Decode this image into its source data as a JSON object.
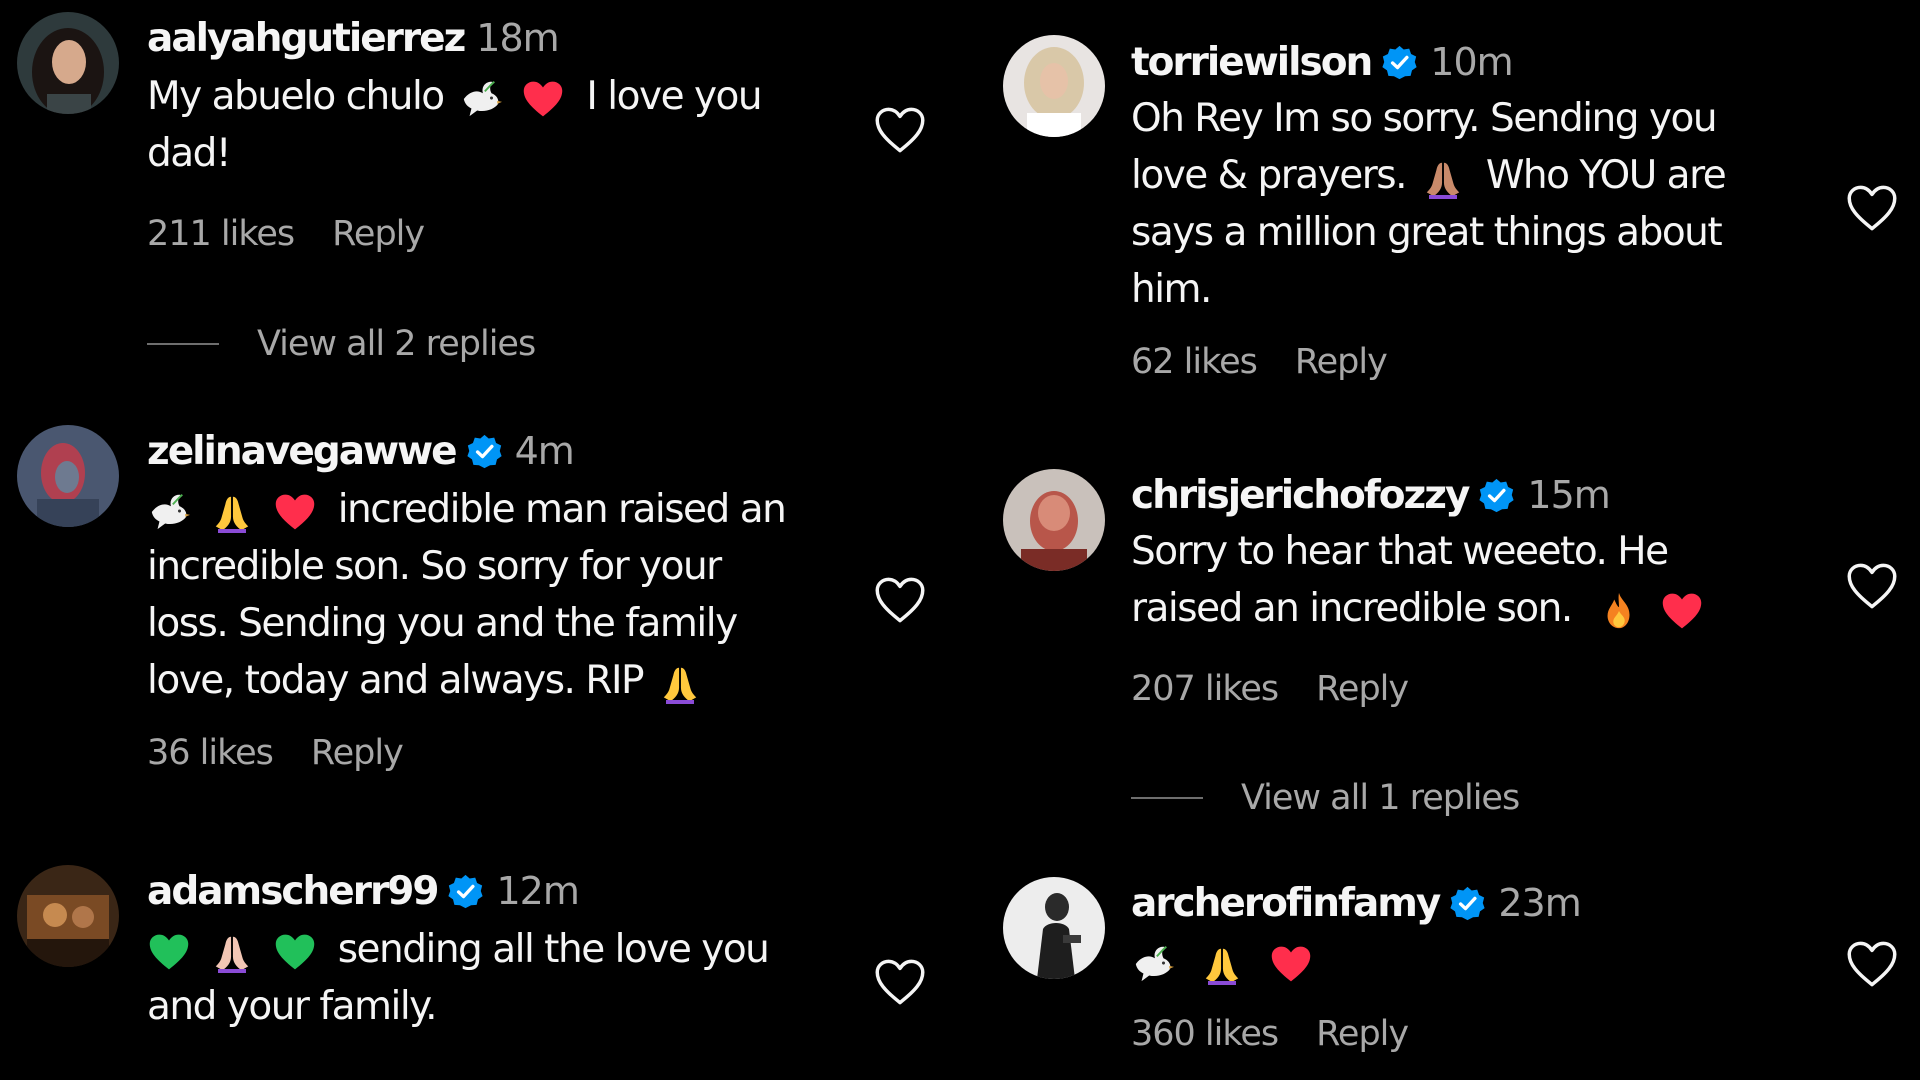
{
  "colors": {
    "background": "#000000",
    "text": "#f5f5f5",
    "muted": "#a8a8a8",
    "verified": "#0095f6",
    "heart_red": "#ff2e4c",
    "heart_green": "#21c05a",
    "hands_yellow": "#ffc83d",
    "hands_purple": "#8a4bd6"
  },
  "comments": [
    {
      "username": "aalyahgutierrez",
      "verified": false,
      "time": "18m",
      "lines": [
        "My abuelo chulo",
        "dad!"
      ],
      "line1_tail": "I love you",
      "likes": "211 likes",
      "reply": "Reply",
      "view_replies": "View all 2 replies",
      "icons": [
        "dove-icon",
        "red-heart-icon",
        "heart-outline-icon"
      ]
    },
    {
      "username": "zelinavegawwe",
      "verified": true,
      "time": "4m",
      "lines": [
        "incredible man raised an",
        "incredible son. So sorry for your",
        "loss. Sending you and the family",
        "love, today and always. RIP"
      ],
      "likes": "36 likes",
      "reply": "Reply",
      "icons": [
        "dove-icon",
        "praying-hands-icon",
        "red-heart-icon",
        "verified-icon",
        "heart-outline-icon"
      ]
    },
    {
      "username": "adamscherr99",
      "verified": true,
      "time": "12m",
      "lines": [
        "sending all the love you",
        "and your family."
      ],
      "icons": [
        "green-heart-icon",
        "praying-hands-icon",
        "verified-icon",
        "heart-outline-icon"
      ]
    },
    {
      "username": "torriewilson",
      "verified": true,
      "time": "10m",
      "lines": [
        "Oh Rey Im so sorry. Sending you",
        "love & prayers.",
        "says a million great things about",
        "him."
      ],
      "line2_tail": "Who YOU are",
      "likes": "62 likes",
      "reply": "Reply",
      "icons": [
        "praying-hands-icon",
        "verified-icon",
        "heart-outline-icon"
      ]
    },
    {
      "username": "chrisjerichofozzy",
      "verified": true,
      "time": "15m",
      "lines": [
        "Sorry to hear that weeeto. He",
        "raised an incredible son."
      ],
      "likes": "207 likes",
      "reply": "Reply",
      "view_replies": "View all 1 replies",
      "icons": [
        "fire-icon",
        "red-heart-icon",
        "verified-icon",
        "heart-outline-icon"
      ]
    },
    {
      "username": "archerofinfamy",
      "verified": true,
      "time": "23m",
      "likes": "360 likes",
      "reply": "Reply",
      "icons": [
        "dove-icon",
        "praying-hands-icon",
        "red-heart-icon",
        "verified-icon",
        "heart-outline-icon"
      ]
    }
  ]
}
